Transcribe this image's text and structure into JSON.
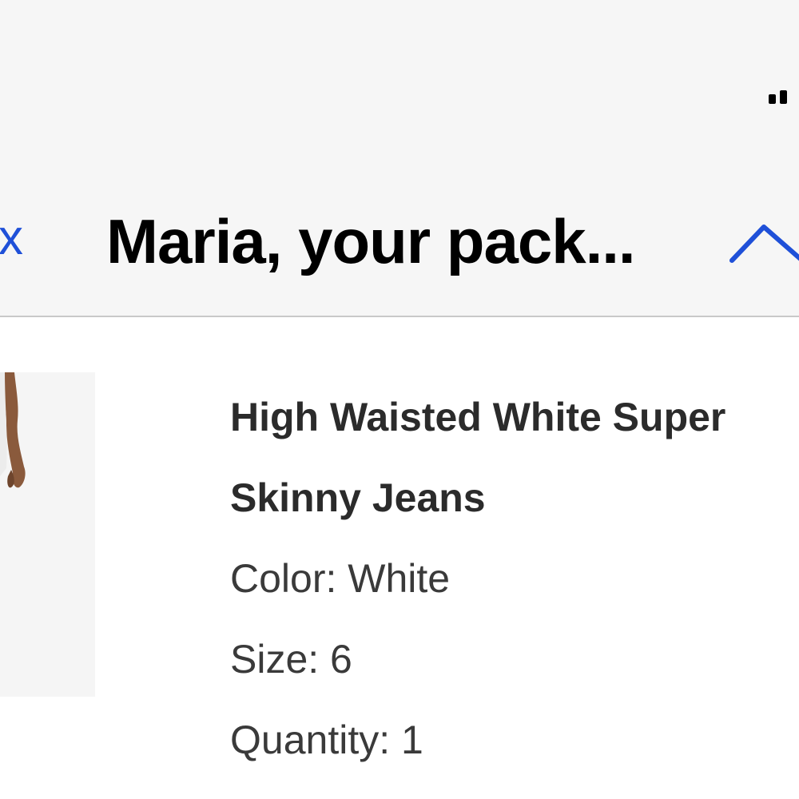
{
  "header": {
    "back_label": "x",
    "title": "Maria, your pack..."
  },
  "product": {
    "name_line1": "High Waisted White Super",
    "name_line2": "Skinny Jeans",
    "color": "Color: White",
    "size": "Size: 6",
    "quantity": "Quantity: 1"
  },
  "colors": {
    "accent": "#1f50d8",
    "header_bg": "#f6f6f6",
    "text_dark": "#2b2b2b"
  },
  "icons": {
    "signal": "signal-bars-icon",
    "nav_up": "chevron-up-icon"
  }
}
